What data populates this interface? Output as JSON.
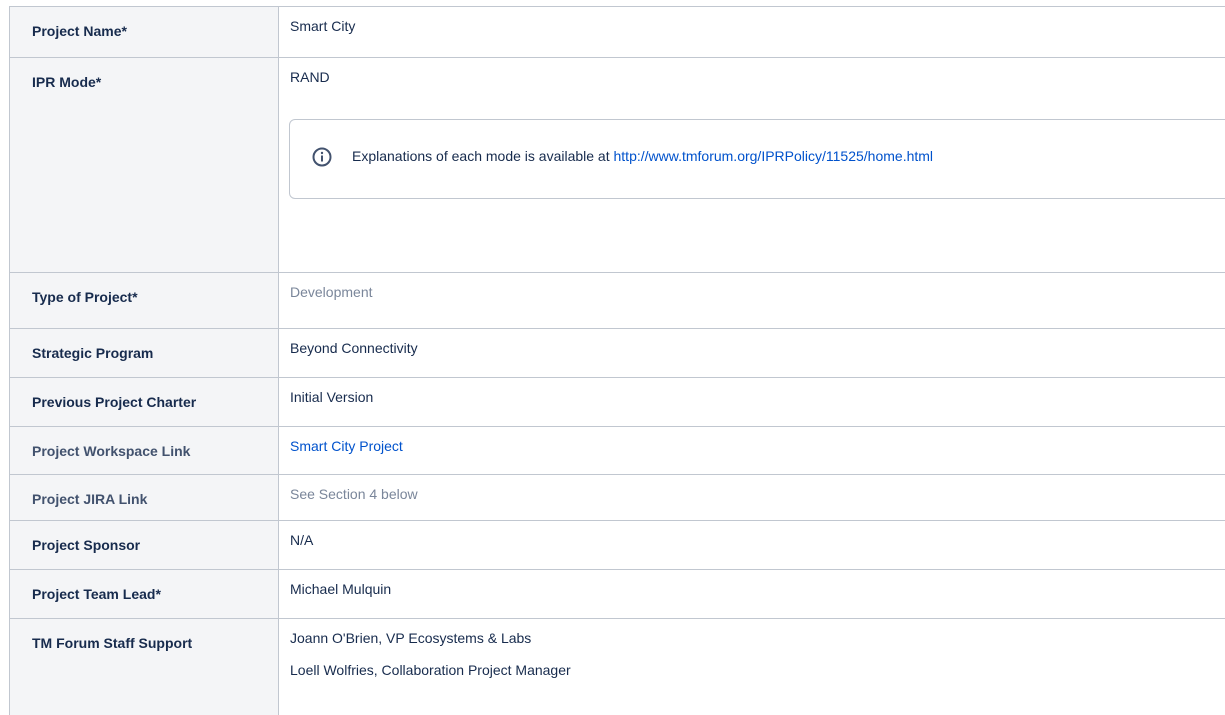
{
  "rows": {
    "project_name": {
      "label": "Project Name*",
      "value": "Smart City"
    },
    "ipr_mode": {
      "label": "IPR Mode*",
      "value": "RAND",
      "info_text": "Explanations of each mode is available at ",
      "info_link": "http://www.tmforum.org/IPRPolicy/11525/home.html",
      "info_icon": "info-circle-icon"
    },
    "type_of_project": {
      "label": "Type of Project*",
      "value": "Development"
    },
    "strategic_program": {
      "label": "Strategic Program",
      "value": "Beyond Connectivity"
    },
    "previous_charter": {
      "label": "Previous Project Charter",
      "value": "Initial Version"
    },
    "workspace_link": {
      "label": "Project Workspace Link",
      "value": "Smart City Project"
    },
    "jira_link": {
      "label": "Project JIRA Link",
      "value": "See Section 4 below"
    },
    "sponsor": {
      "label": "Project Sponsor",
      "value": "N/A"
    },
    "team_lead": {
      "label": "Project Team Lead*",
      "value": "Michael Mulquin"
    },
    "staff_support": {
      "label": "TM Forum Staff Support",
      "values": [
        "Joann O'Brien, VP Ecosystems & Labs",
        "Loell Wolfries, Collaboration Project Manager"
      ]
    }
  },
  "colors": {
    "link": "#0052cc",
    "border": "#c1c7d0",
    "header_bg": "#f4f5f7"
  }
}
